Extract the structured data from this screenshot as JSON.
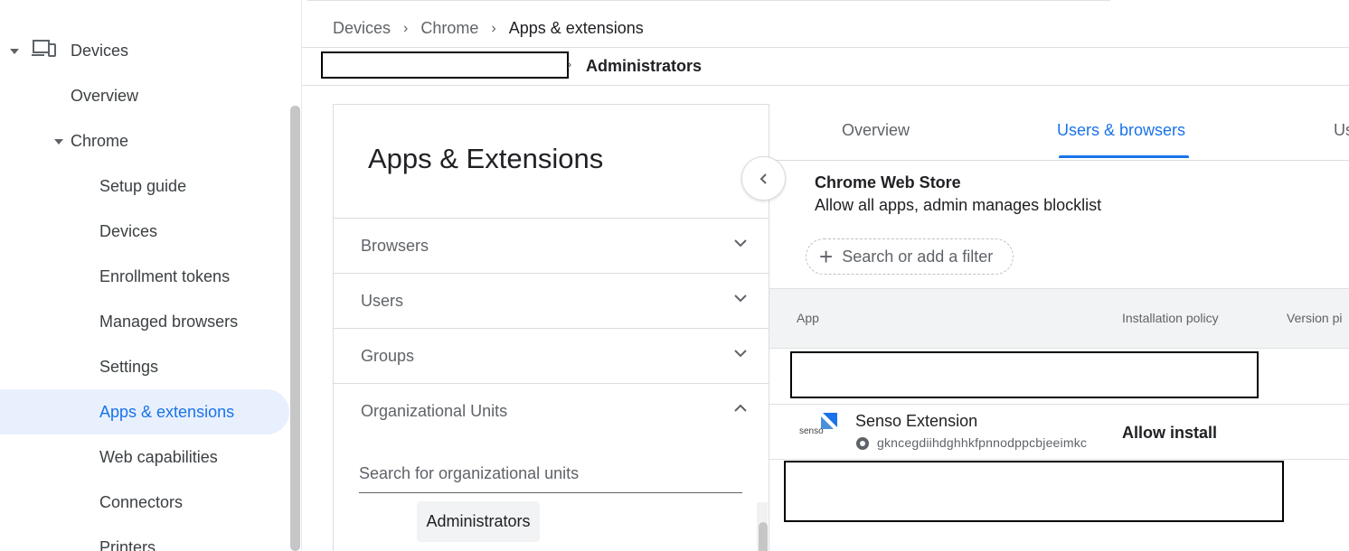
{
  "sidebar": {
    "devices": "Devices",
    "overview": "Overview",
    "chrome": "Chrome",
    "items": [
      {
        "label": "Setup guide"
      },
      {
        "label": "Devices"
      },
      {
        "label": "Enrollment tokens"
      },
      {
        "label": "Managed browsers"
      },
      {
        "label": "Settings"
      },
      {
        "label": "Apps & extensions"
      },
      {
        "label": "Web capabilities"
      },
      {
        "label": "Connectors"
      },
      {
        "label": "Printers"
      }
    ]
  },
  "breadcrumb": [
    "Devices",
    "Chrome",
    "Apps & extensions"
  ],
  "org_path": {
    "current": "Administrators"
  },
  "panel": {
    "title": "Apps & Extensions",
    "sections": [
      "Browsers",
      "Users",
      "Groups",
      "Organizational Units"
    ],
    "search_placeholder": "Search for organizational units",
    "selected_ou": "Administrators"
  },
  "tabs": [
    "Overview",
    "Users & browsers",
    "Us"
  ],
  "store": {
    "title": "Chrome Web Store",
    "subtitle": "Allow all apps, admin manages blocklist"
  },
  "filter": {
    "label": "Search or add a filter"
  },
  "table": {
    "headers": [
      "App",
      "Installation policy",
      "Version pi"
    ],
    "rows": [
      {
        "name": "Senso Extension",
        "id": "gkncegdiihdghhkfpnnodppcbjeeimkc",
        "policy": "Allow install",
        "icon_text": "senso"
      }
    ]
  },
  "colors": {
    "accent": "#1a73e8",
    "active_bg": "#e8f0fe"
  }
}
